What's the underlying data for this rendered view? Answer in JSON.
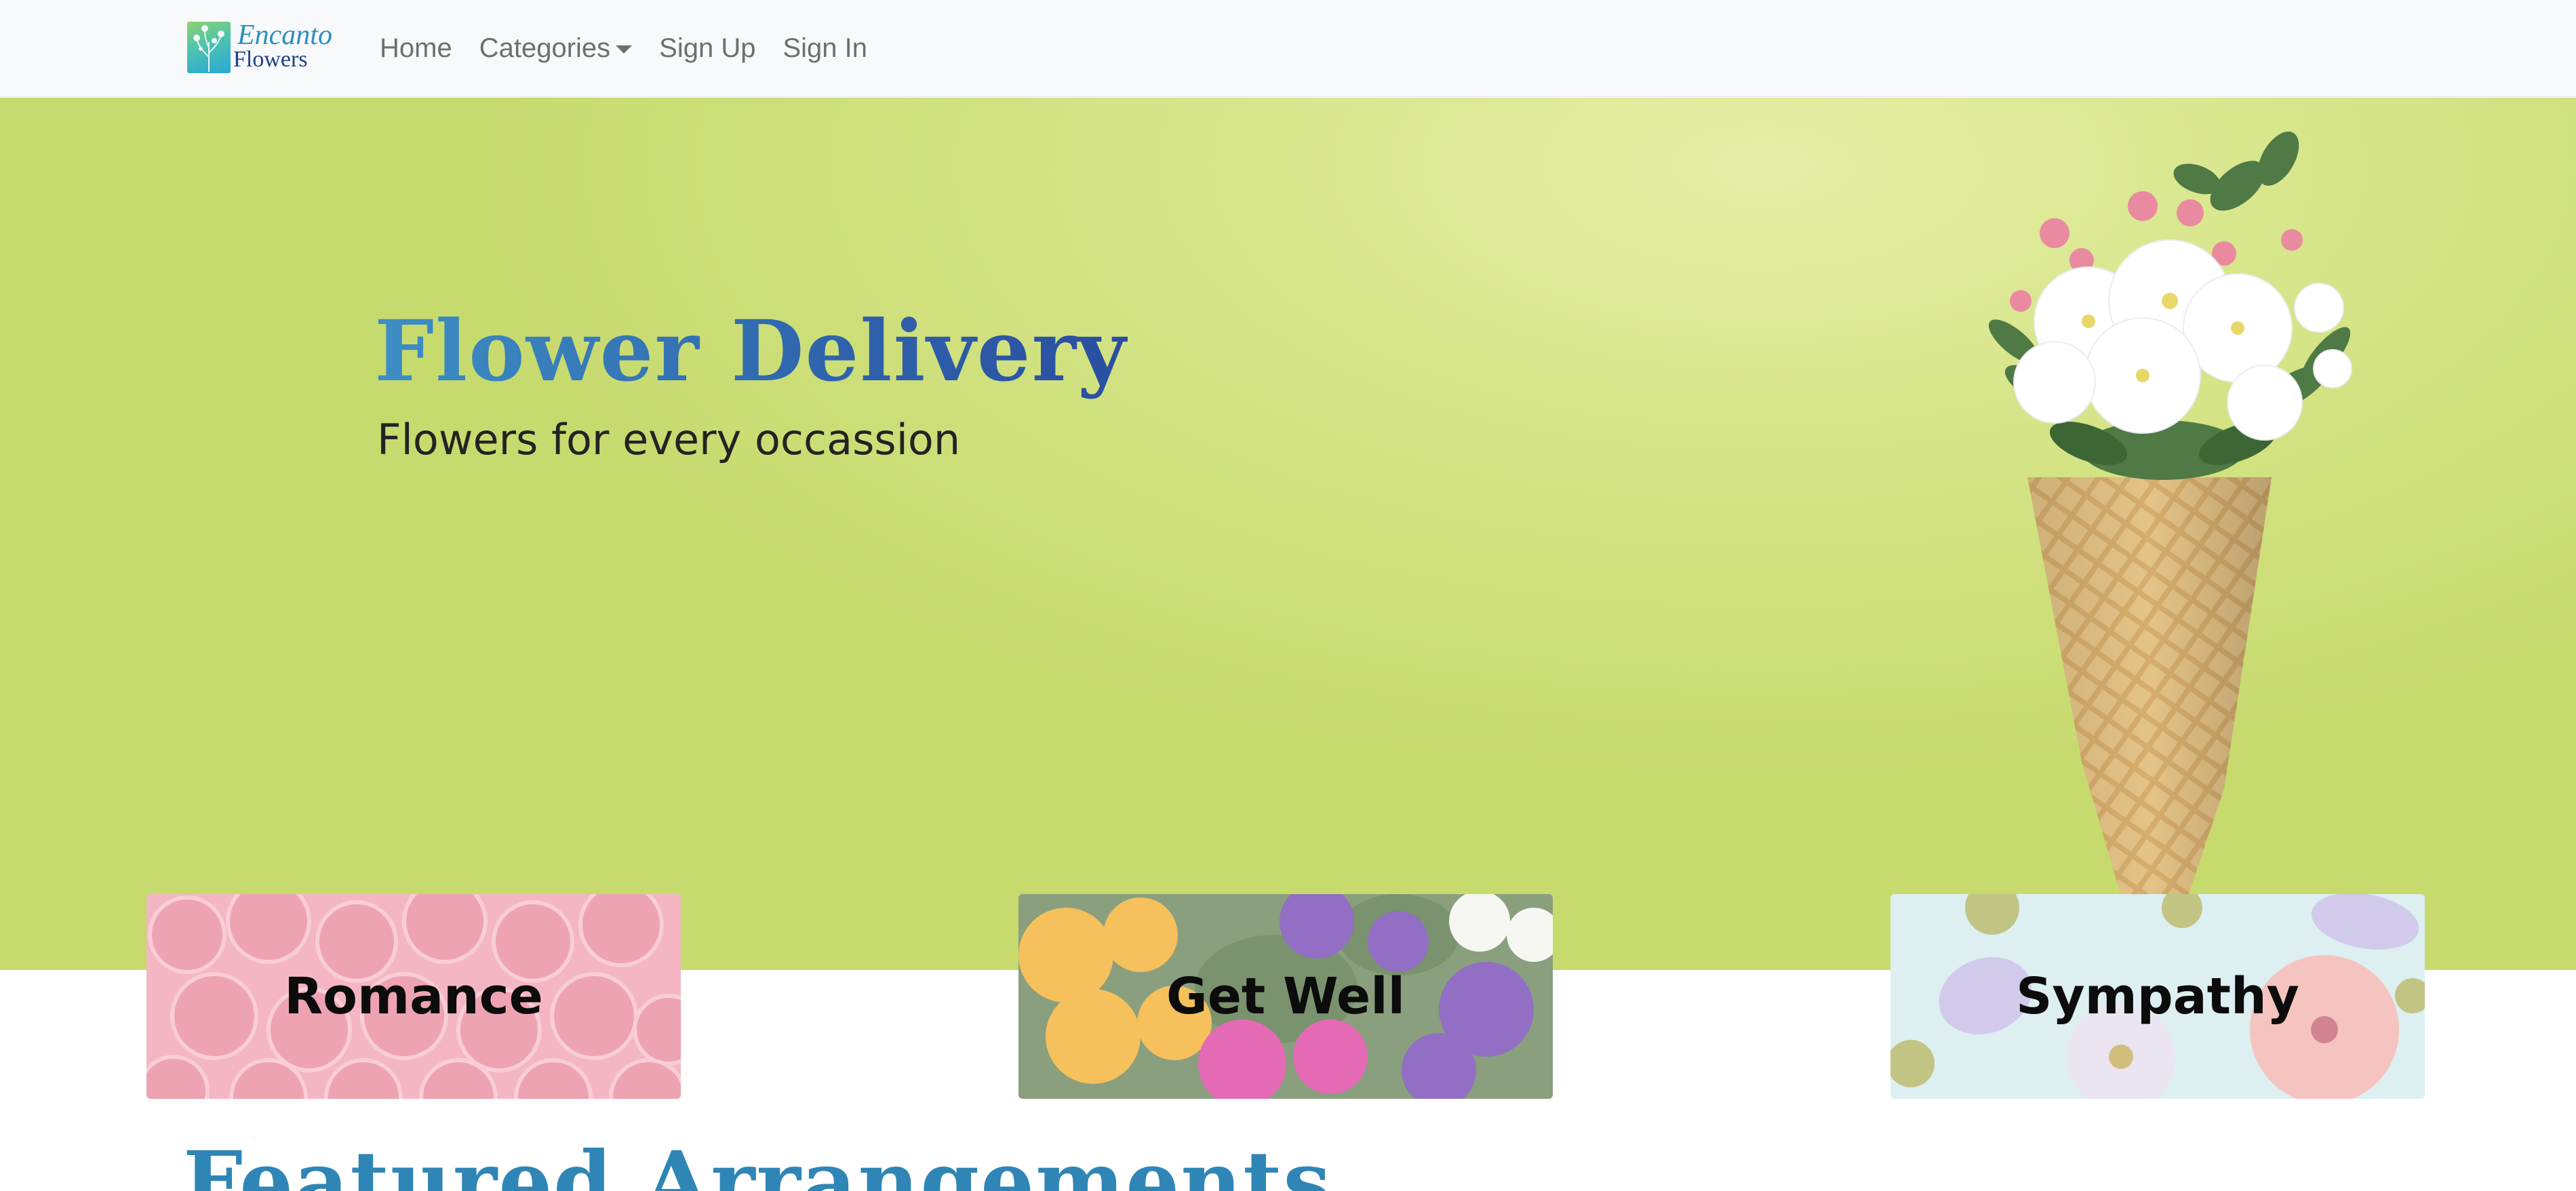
{
  "brand": {
    "word1": "Encanto",
    "word2": "Flowers"
  },
  "nav": {
    "home": "Home",
    "categories": "Categories",
    "sign_up": "Sign Up",
    "sign_in": "Sign In"
  },
  "hero": {
    "title": "Flower Delivery",
    "subtitle": "Flowers for every occassion"
  },
  "categories": [
    {
      "label": "Romance"
    },
    {
      "label": "Get Well"
    },
    {
      "label": "Sympathy"
    }
  ],
  "featured": {
    "heading": "Featured Arrangements"
  },
  "colors": {
    "navbar_bg": "#f8f9fb",
    "hero_bg": "#d6e589",
    "title_blue": "#2f64ad",
    "featured_blue": "#2f86b6"
  }
}
